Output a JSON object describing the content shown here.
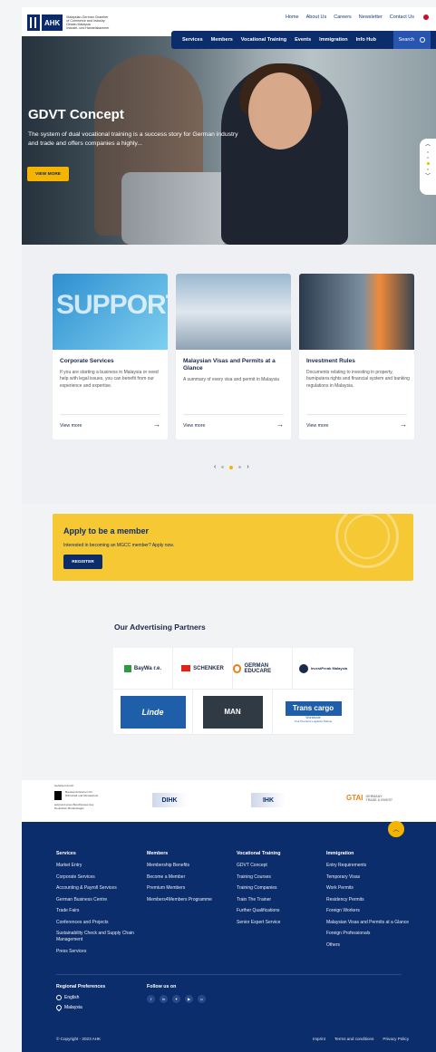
{
  "header": {
    "logo": {
      "abbr": "AHK",
      "lines": [
        "Malaysian-German Chamber",
        "of Commerce and Industry",
        "Dewan Malaysia",
        "Industri- und Handelskammer"
      ]
    },
    "top_links": [
      "Home",
      "About Us",
      "Careers",
      "Newsletter",
      "Contact Us"
    ],
    "nav": [
      "Services",
      "Members",
      "Vocational Training",
      "Events",
      "Immigration",
      "Info Hub"
    ],
    "search_label": "Search"
  },
  "hero": {
    "title": "GDVT Concept",
    "text": "The system of dual vocational training is a success story for German industry and trade and offers companies a highly...",
    "button": "VIEW MORE",
    "active_slide": 3,
    "slide_count": 4
  },
  "cards": [
    {
      "title": "Corporate Services",
      "desc": "If you are starting a business in Malaysia or need help with legal issues, you can benefit from our experience and expertise.",
      "link": "View more",
      "image_text": "SUPPORT"
    },
    {
      "title": "Malaysian Visas and Permits at a Glance",
      "desc": "A summary of every visa and permit in Malaysia",
      "link": "View more"
    },
    {
      "title": "Investment Rules",
      "desc": "Documents relating to investing in property, bumiputera rights and financial system and banking regulations in Malaysia.",
      "link": "View more"
    }
  ],
  "member": {
    "title": "Apply to be a member",
    "text": "Interested in becoming an MGCC member? Apply now.",
    "button": "REGISTER"
  },
  "partners": {
    "title": "Our Advertising Partners",
    "items": [
      "BayWa r.e.",
      "SCHENKER",
      "GERMAN EDUCARE",
      "InvestPerak Malaysia",
      "Linde",
      "MAN",
      "Trans cargo",
      "Worldwide",
      "Your Premium Logistics Partner"
    ]
  },
  "gov": {
    "bmwi": [
      "Gefördert durch:",
      "Bundesministerium für Wirtschaft und Klimaschutz",
      "aufgrund eines Beschlusses des Deutschen Bundestages"
    ],
    "dihk": "DIHK",
    "ihk": "IHK",
    "gtai": "GTAI",
    "gtai_sub": [
      "GERMANY",
      "TRADE & INVEST"
    ]
  },
  "footer": {
    "cols": [
      {
        "title": "Services",
        "items": [
          "Market Entry",
          "Corporate Services",
          "Accounting & Payroll Services",
          "German Business Centre",
          "Trade Fairs",
          "Conferences and Projects",
          "Sustainability Check and Supply Chain Management",
          "Press Services"
        ]
      },
      {
        "title": "Members",
        "items": [
          "Membership Benefits",
          "Become a Member",
          "Premium Members",
          "Members4Members Programme"
        ]
      },
      {
        "title": "Vocational Training",
        "items": [
          "GDVT Concept",
          "Training Courses",
          "Training Companies",
          "Train The Trainer",
          "Further Qualifications",
          "Senior Expert Service"
        ]
      },
      {
        "title": "Immigration",
        "items": [
          "Entry Requirements",
          "Temporary Visas",
          "Work Permits",
          "Residency Permits",
          "Foreign Workers",
          "Malaysian Visas and Permits at a Glance",
          "Foreign Professionals",
          "Others"
        ]
      }
    ],
    "regional": {
      "title": "Regional Preferences",
      "language": "English",
      "country": "Malaysia"
    },
    "follow": {
      "title": "Follow us on",
      "socials": [
        "f",
        "in",
        "tw",
        "yt",
        "fl"
      ]
    },
    "copyright": "© Copyright - 2023 AHK",
    "links": [
      "Imprint",
      "Terms and conditions",
      "Privacy Policy"
    ]
  }
}
